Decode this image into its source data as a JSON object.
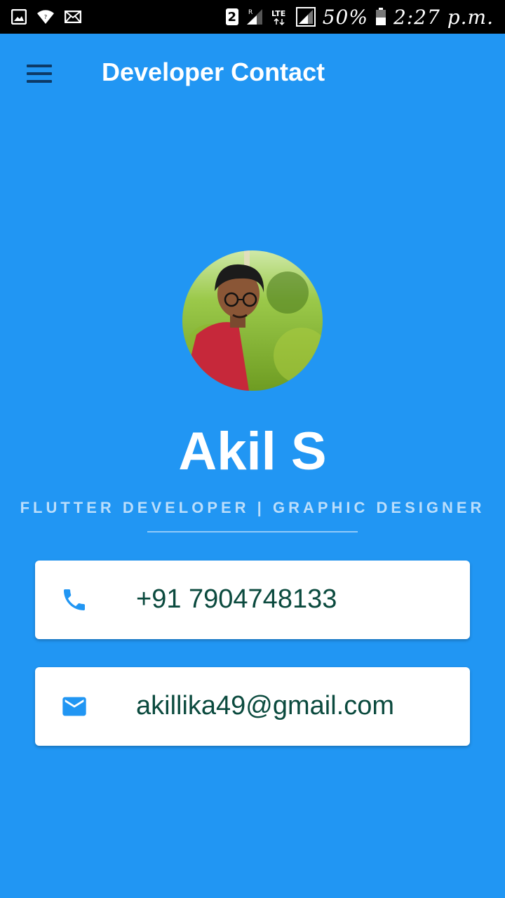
{
  "status_bar": {
    "sim_slot": "2",
    "roaming": "R",
    "network": "LTE",
    "battery": "50%",
    "time": "2:27 p.m."
  },
  "app_bar": {
    "title": "Developer Contact"
  },
  "profile": {
    "name": "Akil S",
    "role": "FLUTTER DEVELOPER | GRAPHIC DESIGNER"
  },
  "contacts": {
    "phone": "+91 7904748133",
    "email": "akillika49@gmail.com"
  },
  "colors": {
    "background": "#2196F3",
    "accent_icon": "#2196F3",
    "contact_text": "#0B4A3E"
  },
  "icons": {
    "menu": "menu-icon",
    "phone": "phone-icon",
    "email": "mail-icon"
  }
}
